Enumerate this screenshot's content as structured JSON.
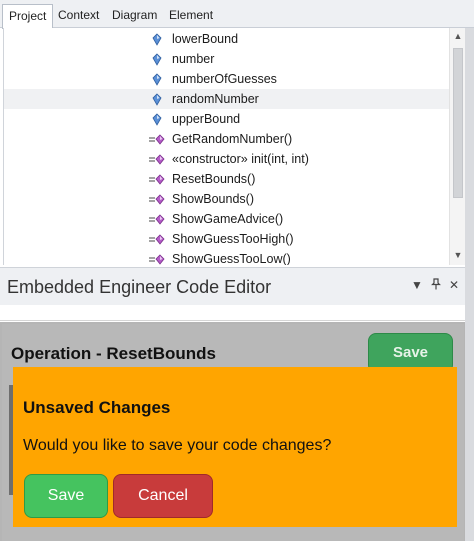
{
  "tabs": [
    {
      "label": "Project",
      "active": true
    },
    {
      "label": "Context",
      "active": false
    },
    {
      "label": "Diagram",
      "active": false
    },
    {
      "label": "Element",
      "active": false
    }
  ],
  "tree": {
    "selected_index": 3,
    "items": [
      {
        "label": "lowerBound",
        "icon": "attribute-icon"
      },
      {
        "label": "number",
        "icon": "attribute-icon"
      },
      {
        "label": "numberOfGuesses",
        "icon": "attribute-icon"
      },
      {
        "label": "randomNumber",
        "icon": "attribute-icon"
      },
      {
        "label": "upperBound",
        "icon": "attribute-icon"
      },
      {
        "label": "GetRandomNumber()",
        "icon": "operation-icon"
      },
      {
        "label": "«constructor» init(int, int)",
        "icon": "operation-icon"
      },
      {
        "label": "ResetBounds()",
        "icon": "operation-icon"
      },
      {
        "label": "ShowBounds()",
        "icon": "operation-icon"
      },
      {
        "label": "ShowGameAdvice()",
        "icon": "operation-icon"
      },
      {
        "label": "ShowGuessTooHigh()",
        "icon": "operation-icon"
      },
      {
        "label": "ShowGuessTooLow()",
        "icon": "operation-icon"
      }
    ]
  },
  "panel": {
    "title": "Embedded Engineer Code Editor",
    "dropdown_icon": "chevron-down-icon",
    "pin_icon": "pin-icon",
    "close_icon": "close-icon"
  },
  "editor": {
    "operation_title": "Operation - ResetBounds",
    "save_label": "Save"
  },
  "dialog": {
    "title": "Unsaved Changes",
    "message": "Would you like to save your code changes?",
    "save_label": "Save",
    "cancel_label": "Cancel"
  },
  "colors": {
    "dialog_bg": "#ffa500",
    "save_green": "#45c35f",
    "cancel_red": "#c83b3b",
    "editor_gray": "#b5b5b5"
  }
}
